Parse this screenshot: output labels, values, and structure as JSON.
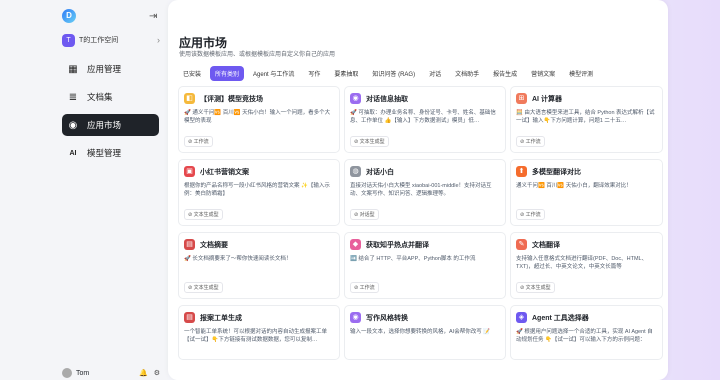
{
  "sidebar": {
    "logo": "D",
    "collapse_icon": "sidebar-collapse-icon",
    "workspace": {
      "initial": "T",
      "name": "T的工作空间",
      "arrow": "›"
    },
    "items": [
      {
        "label": "应用管理",
        "icon": "▦"
      },
      {
        "label": "文档集",
        "icon": "≣"
      },
      {
        "label": "应用市场",
        "icon": "◉",
        "active": true
      },
      {
        "label": "模型管理",
        "icon": "AI"
      }
    ],
    "user": {
      "name": "Tom",
      "icons": [
        "bell-icon",
        "gear-icon"
      ]
    }
  },
  "main": {
    "title": "应用市场",
    "subtitle": "使用该数据模板应用、或根据模板应用自定义你自己的应用",
    "tabs": [
      "已安装",
      "所有类别",
      "Agent 与工作流",
      "写作",
      "要素抽取",
      "知识问答 (RAG)",
      "对话",
      "文档助手",
      "报告生成",
      "营销文案",
      "模型评测"
    ],
    "active_tab": 1,
    "cards": [
      {
        "title": "【评测】模型竞技场",
        "desc": "🚀 通义千问🆚 百川🆚 天佑小白！输入一个问题，看多个大模型的表现",
        "tag": "工作流",
        "color": "#f5b93b"
      },
      {
        "title": "对话信息抽取",
        "desc": "🚀 可抽取：办理业务名称、身份证号、卡号、姓名、基础信息、工作单位 👍【输入】下方数据测试」模员」低…",
        "tag": "文本生成型",
        "color": "#9b6cf0"
      },
      {
        "title": "AI 计算器",
        "desc": "🧮 由大语言模型来进工具，结合 Python 表达式解析【试一试】输入👇下方问题计算，问题1 二十五…",
        "tag": "工作流",
        "color": "#f07a5c"
      },
      {
        "title": "小红书营销文案",
        "desc": "根据你的产品名称写一段小红书风格的营销文案 ✨【输入示例：美白防晒霜】",
        "tag": "文本生成型",
        "color": "#e5484d"
      },
      {
        "title": "对话小白",
        "desc": "直接对话天佑小白大模型 xiaobai-001-middle！支持对话互动、文案写作、知识问答、逻辑推理等。",
        "tag": "对话型",
        "color": "#8f959e"
      },
      {
        "title": "多模型翻译对比",
        "desc": "通义千问🆚 百川🆚 天佑小白，翻译效果对比！",
        "tag": "工作流",
        "color": "#f56c2d"
      },
      {
        "title": "文档摘要",
        "desc": "🚀 长文档摘要来了～帮你快速阅读长文档！",
        "tag": "文本生成型",
        "color": "#d64a4a"
      },
      {
        "title": "获取知乎热点并翻译",
        "desc": "➡️ 结合了 HTTP、平台APP、Python脚本 的工作流",
        "tag": "工作流",
        "color": "#e8609c"
      },
      {
        "title": "文档翻译",
        "desc": "支持输入任意格式文档进行翻译(PDF、Doc、HTML、TXT)，超过长、中英文论文，中英文长篇等",
        "tag": "文本生成型",
        "color": "#ef6b52"
      },
      {
        "title": "报案工单生成",
        "desc": "一个智能工单系统！可以根据对话的内容自动生成报案工单【试一试】👇下方链接有测试数据数据，您可以复制…",
        "tag": "",
        "color": "#d64a4a"
      },
      {
        "title": "写作风格转换",
        "desc": "输入一段文本，选择你想要转换的风格，AI会帮你改写 📝",
        "tag": "",
        "color": "#9b6cf0"
      },
      {
        "title": "Agent 工具选择器",
        "desc": "🚀 根据用户问题选择一个合适的工具，实现 AI Agent 自动规划任务 👇【试一试】可以输入下方的示例问题：",
        "tag": "",
        "color": "#6e59f0"
      }
    ]
  },
  "colors": {
    "accent": "#6e59f0",
    "active_nav": "#1f2329"
  }
}
